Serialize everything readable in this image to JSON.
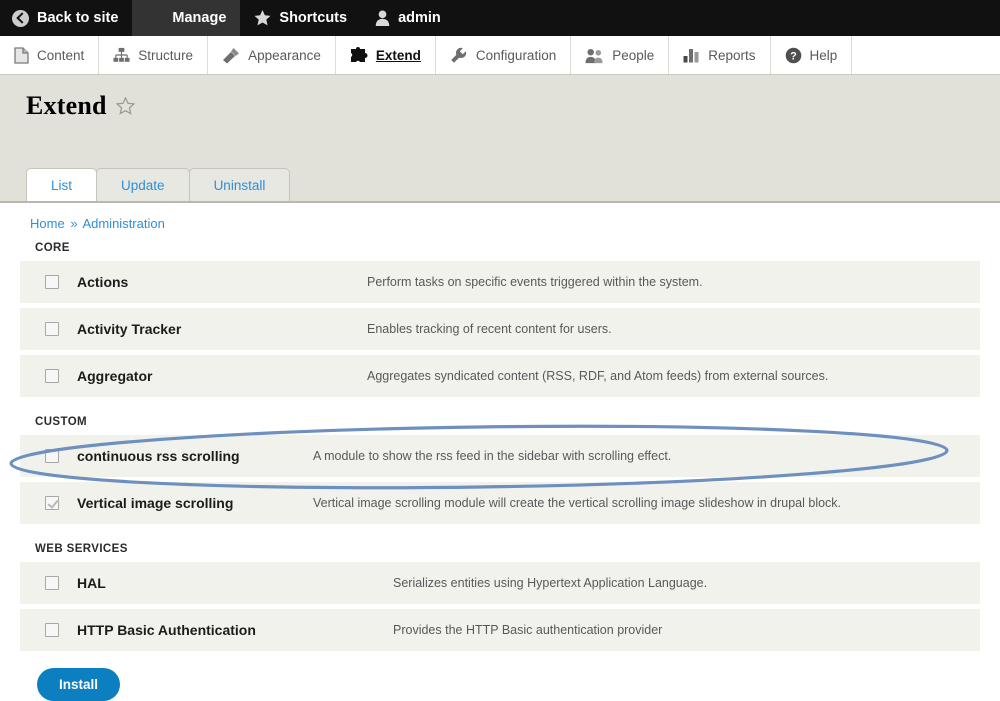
{
  "admin_bar": {
    "items": [
      {
        "label": "Back to site",
        "icon": "back-arrow-icon",
        "active": false
      },
      {
        "label": "Manage",
        "icon": "hamburger-icon",
        "active": true
      },
      {
        "label": "Shortcuts",
        "icon": "star-icon",
        "active": false
      },
      {
        "label": "admin",
        "icon": "user-icon",
        "active": false
      }
    ]
  },
  "nav_bar": {
    "items": [
      {
        "label": "Content",
        "icon": "document-icon",
        "active": false
      },
      {
        "label": "Structure",
        "icon": "structure-icon",
        "active": false
      },
      {
        "label": "Appearance",
        "icon": "paintbrush-icon",
        "active": false
      },
      {
        "label": "Extend",
        "icon": "puzzle-piece-icon",
        "active": true
      },
      {
        "label": "Configuration",
        "icon": "wrench-icon",
        "active": false
      },
      {
        "label": "People",
        "icon": "people-icon",
        "active": false
      },
      {
        "label": "Reports",
        "icon": "bar-chart-icon",
        "active": false
      },
      {
        "label": "Help",
        "icon": "question-mark-icon",
        "active": false
      }
    ]
  },
  "page": {
    "title": "Extend",
    "favorite_icon": "star-outline-icon",
    "tabs": [
      {
        "label": "List",
        "active": true
      },
      {
        "label": "Update",
        "active": false
      },
      {
        "label": "Uninstall",
        "active": false
      }
    ],
    "breadcrumb": {
      "home": "Home",
      "separator": "»",
      "current": "Administration"
    }
  },
  "groups": [
    {
      "heading": "CORE",
      "modules": [
        {
          "name": "Actions",
          "description": "Perform tasks on specific events triggered within the system.",
          "checked": false
        },
        {
          "name": "Activity Tracker",
          "description": "Enables tracking of recent content for users.",
          "checked": false
        },
        {
          "name": "Aggregator",
          "description": "Aggregates syndicated content (RSS, RDF, and Atom feeds) from external sources.",
          "checked": false
        }
      ]
    },
    {
      "heading": "CUSTOM",
      "modules": [
        {
          "name": "continuous rss scrolling",
          "description": "A module to show the rss feed in the sidebar with scrolling effect.",
          "checked": false
        },
        {
          "name": "Vertical image scrolling",
          "description": "Vertical image scrolling module will create the vertical scrolling image slideshow in drupal block.",
          "checked": true
        }
      ]
    },
    {
      "heading": "WEB SERVICES",
      "modules": [
        {
          "name": "HAL",
          "description": "Serializes entities using Hypertext Application Language.",
          "checked": false
        },
        {
          "name": "HTTP Basic Authentication",
          "description": "Provides the HTTP Basic authentication provider",
          "checked": false
        }
      ]
    }
  ],
  "footer": {
    "install_label": "Install"
  },
  "annotation": {
    "shape": "ellipse",
    "target": "Vertical image scrolling",
    "color": "#6d90bf"
  },
  "colors": {
    "admin_bar_bg": "#111111",
    "active_tab_bg": "#333333",
    "header_bg": "#e1e1da",
    "row_bg": "#f2f2ed",
    "link_blue": "#2f8fd6",
    "button_blue": "#0c7fc1",
    "annotation_blue": "#6d90bf"
  }
}
